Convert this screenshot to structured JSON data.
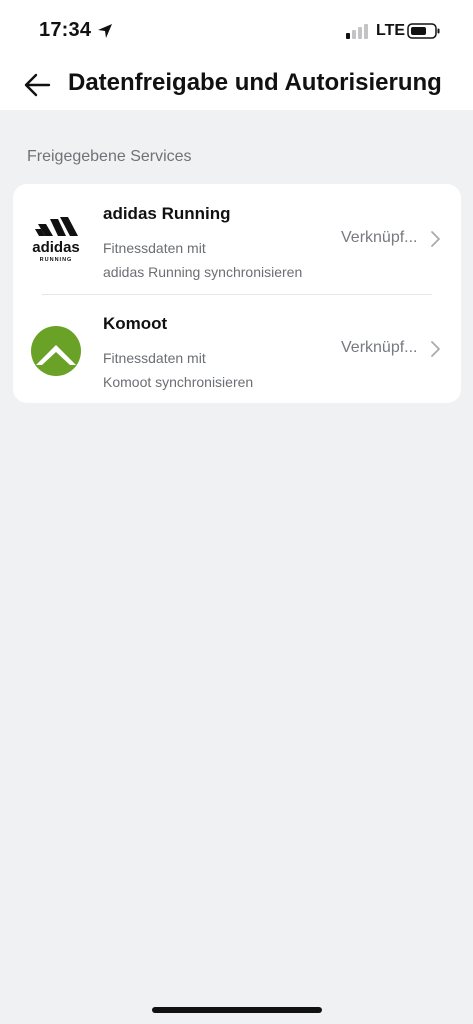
{
  "status_bar": {
    "time": "17:34",
    "network": "LTE",
    "icons": [
      "location-arrow-icon",
      "signal-bars-icon",
      "battery-icon"
    ]
  },
  "header": {
    "title": "Datenfreigabe und Autorisierung",
    "back_icon": "back-arrow-icon"
  },
  "section": {
    "label": "Freigegebene Services"
  },
  "services": [
    {
      "name": "adidas Running",
      "description_line1": "Fitnessdaten mit",
      "description_line2": "adidas Running synchronisieren",
      "status": "Verknüpf...",
      "logo_text": "adidas",
      "logo_subtext": "RUNNING",
      "logo_icon": "adidas-running-logo"
    },
    {
      "name": "Komoot",
      "description_line1": "Fitnessdaten mit",
      "description_line2": "Komoot synchronisieren",
      "status": "Verknüpf...",
      "logo_icon": "komoot-logo",
      "logo_color": "#6aa127"
    }
  ]
}
